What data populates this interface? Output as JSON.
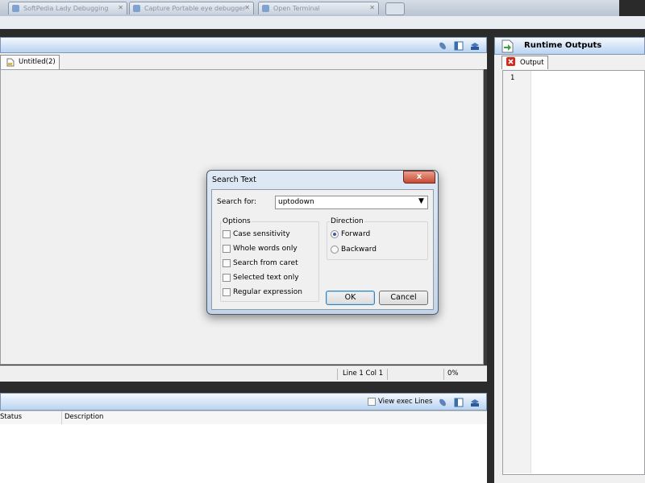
{
  "browser_tabs": [
    {
      "label": "SoftPedia Lady Debugging"
    },
    {
      "label": "Capture Portable eye debugger"
    },
    {
      "label": "Open Terminal"
    }
  ],
  "editor": {
    "tab_label": "Untitled(2)",
    "status_line": "Line 1",
    "status_col": "Col 1",
    "status_percent": "0%"
  },
  "bottom_pane": {
    "view_exec_label": "View exec Lines",
    "columns": [
      "Status",
      "Description"
    ]
  },
  "runtime_outputs": {
    "title": "Runtime Outputs",
    "tab_label": "Output",
    "line_numbers": [
      "1"
    ]
  },
  "search_dialog": {
    "title": "Search Text",
    "close_glyph": "x",
    "search_label": "Search for:",
    "search_value": "uptodown",
    "options_title": "Options",
    "options": [
      {
        "label": "Case sensitivity",
        "checked": false
      },
      {
        "label": "Whole words only",
        "checked": false
      },
      {
        "label": "Search from caret",
        "checked": false
      },
      {
        "label": "Selected text only",
        "checked": false
      },
      {
        "label": "Regular expression",
        "checked": false
      }
    ],
    "direction_title": "Direction",
    "directions": [
      {
        "label": "Forward",
        "selected": true
      },
      {
        "label": "Backward",
        "selected": false
      }
    ],
    "ok_label": "OK",
    "cancel_label": "Cancel"
  }
}
